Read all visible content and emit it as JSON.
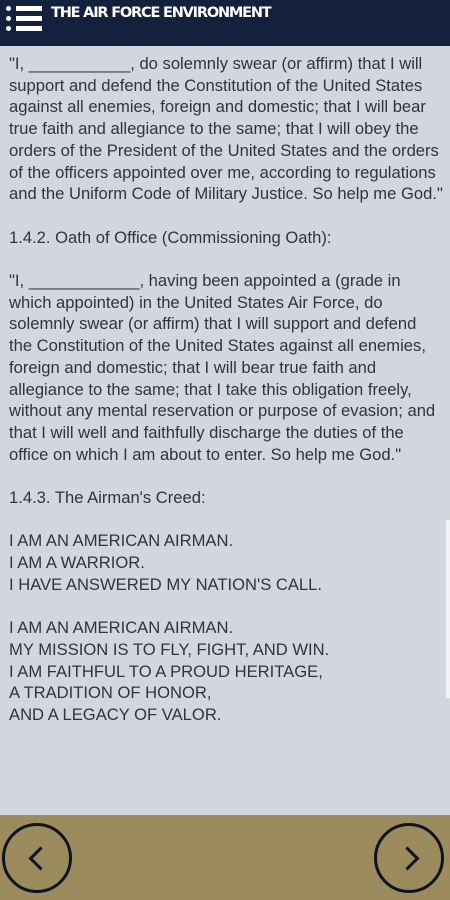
{
  "header": {
    "title": "THE AIR FORCE ENVIRONMENT",
    "menu_icon": "menu-list-icon",
    "background": "#13213d"
  },
  "content": {
    "paragraphs": [
      "\"I, ___________, do solemnly swear (or affirm) that I will support and defend the Constitution of the United States against all enemies, foreign and domestic; that I will bear true faith and allegiance to the same; that I will obey the orders of the President of the United States and the orders of the officers appointed over me, according to regulations and the Uniform Code of Military Justice. So help me God.\"",
      "1.4.2. Oath of Office (Commissioning Oath):",
      "\"I, ____________, having been appointed a (grade in which appointed) in the United States Air Force, do solemnly swear (or affirm) that I will support and defend the Constitution of the United States against all enemies, foreign and domestic; that I will bear true faith and allegiance to the same; that I take this obligation freely, without any mental reservation or purpose of evasion; and that I will well and faithfully discharge the duties of the office on which I am about to enter. So help me God.\"",
      "1.4.3. The Airman's Creed:"
    ],
    "creed_stanza_1": [
      "I AM AN AMERICAN AIRMAN.",
      "I AM A WARRIOR.",
      "I HAVE ANSWERED MY NATION'S CALL."
    ],
    "creed_stanza_2": [
      "I AM AN AMERICAN AIRMAN.",
      "MY MISSION IS TO FLY, FIGHT, AND WIN.",
      "I AM FAITHFUL TO A PROUD HERITAGE,",
      "A TRADITION OF HONOR,",
      "AND A LEGACY OF VALOR."
    ],
    "background": "#d3d6df",
    "text_color": "#30343d"
  },
  "footer": {
    "prev_icon": "chevron-left-icon",
    "next_icon": "chevron-right-icon",
    "background": "#9c8b5c"
  }
}
